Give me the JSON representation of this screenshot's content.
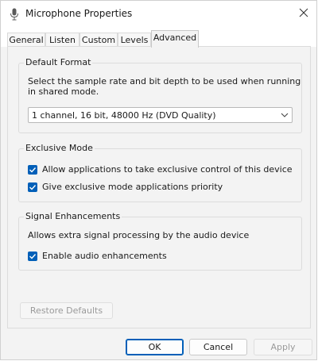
{
  "window": {
    "title": "Microphone Properties",
    "close_glyph": "✕"
  },
  "tabs": [
    {
      "label": "General"
    },
    {
      "label": "Listen"
    },
    {
      "label": "Custom"
    },
    {
      "label": "Levels"
    },
    {
      "label": "Advanced",
      "active": true
    }
  ],
  "default_format": {
    "title": "Default Format",
    "description_line1": "Select the sample rate and bit depth to be used when running",
    "description_line2": "in shared mode.",
    "selected_value": "1 channel, 16 bit, 48000 Hz (DVD Quality)"
  },
  "exclusive_mode": {
    "title": "Exclusive Mode",
    "options": [
      {
        "label": "Allow applications to take exclusive control of this device",
        "checked": true
      },
      {
        "label": "Give exclusive mode applications priority",
        "checked": true
      }
    ]
  },
  "signal_enhancements": {
    "title": "Signal Enhancements",
    "description": "Allows extra signal processing by the audio device",
    "options": [
      {
        "label": "Enable audio enhancements",
        "checked": true
      }
    ]
  },
  "restore_defaults_label": "Restore Defaults",
  "buttons": {
    "ok": "OK",
    "cancel": "Cancel",
    "apply": "Apply"
  },
  "colors": {
    "accent": "#005fb8",
    "window_bg": "#f3f3f3",
    "titlebar_bg": "#ffffff"
  },
  "icons": {
    "window": "microphone-icon",
    "close": "close-icon",
    "dropdown": "chevron-down-icon",
    "check": "checkmark-icon"
  }
}
